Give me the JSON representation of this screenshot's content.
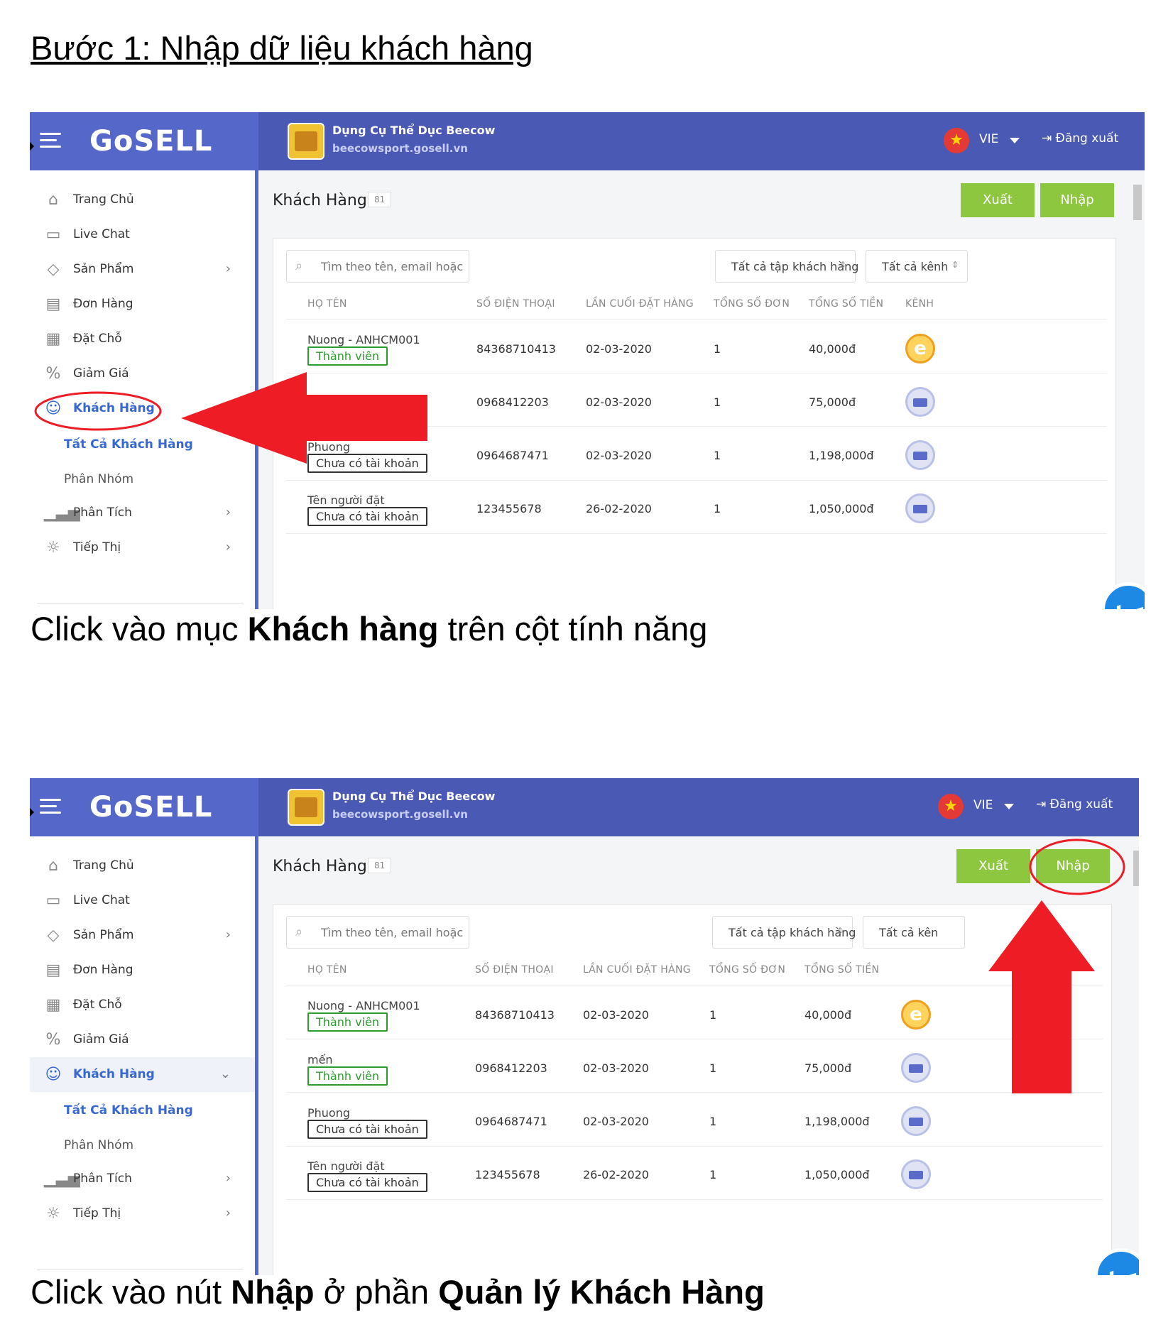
{
  "document": {
    "heading": "Bước 1: Nhập dữ liệu khách hàng",
    "caption1": {
      "pre": "Click vào mục ",
      "bold": "Khách hàng",
      "post": " trên cột tính năng"
    },
    "caption2": {
      "pre": "Click vào nút ",
      "bold1": "Nhập",
      "mid": " ở phần ",
      "bold2": "Quản lý Khách Hàng"
    }
  },
  "app": {
    "logo": "GoSELL",
    "store_name": "Dụng Cụ Thể Dục Beecow",
    "store_url": "beecowsport.gosell.vn",
    "language": "VIE",
    "logout": "Đăng xuất"
  },
  "sidebar": {
    "items": [
      {
        "label": "Trang Chủ",
        "icon": "home-icon"
      },
      {
        "label": "Live Chat",
        "icon": "chat-icon"
      },
      {
        "label": "Sản Phẩm",
        "icon": "tag-icon"
      },
      {
        "label": "Đơn Hàng",
        "icon": "receipt-icon"
      },
      {
        "label": "Đặt Chỗ",
        "icon": "calendar-icon"
      },
      {
        "label": "Giảm Giá",
        "icon": "discount-icon"
      },
      {
        "label": "Khách Hàng",
        "icon": "users-icon"
      },
      {
        "label": "Tất Cả Khách Hàng"
      },
      {
        "label": "Phân Nhóm"
      },
      {
        "label": "Phân Tích",
        "icon": "analytics-icon"
      },
      {
        "label": "Tiếp Thị",
        "icon": "bulb-icon"
      }
    ]
  },
  "page": {
    "title": "Khách Hàng",
    "count": "81",
    "export_label": "Xuất",
    "import_label": "Nhập",
    "search_placeholder": "Tìm theo tên, email hoặc",
    "segment_select": "Tất cả tập khách hàng",
    "channel_select": "Tất cả kênh",
    "channel_select_partial": "Tất cả kên",
    "columns": [
      "HỌ TÊN",
      "SỐ ĐIỆN THOẠI",
      "LẦN CUỐI ĐẶT HÀNG",
      "TỔNG SỐ ĐƠN",
      "TỔNG SỐ TIỀN",
      "KÊNH"
    ]
  },
  "customers": [
    {
      "name": "Nuong - ANHCM001",
      "status": "Thành viên",
      "phone": "84368710413",
      "last_order": "02-03-2020",
      "orders": "1",
      "total": "40,000đ",
      "channel": "e-icon"
    },
    {
      "name": "mến",
      "status": "Thành viên",
      "phone": "0968412203",
      "last_order": "02-03-2020",
      "orders": "1",
      "total": "75,000đ",
      "channel": "store-icon"
    },
    {
      "name": "Phuong",
      "status": "Chưa có tài khoản",
      "phone": "0964687471",
      "last_order": "02-03-2020",
      "orders": "1",
      "total": "1,198,000đ",
      "channel": "store-icon"
    },
    {
      "name": "Tên người đặt",
      "status": "Chưa có tài khoản",
      "phone": "123455678",
      "last_order": "26-02-2020",
      "orders": "1",
      "total": "1,050,000đ",
      "channel": "store-icon"
    }
  ],
  "colors": {
    "topbar": "#4a59b4",
    "logo_area": "#5567c9",
    "accent_blue": "#3568d4",
    "button_green": "#8dc63f",
    "annotation_red": "#ee1c25"
  }
}
